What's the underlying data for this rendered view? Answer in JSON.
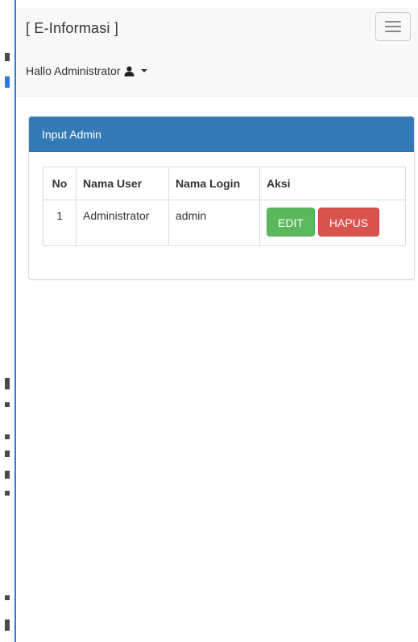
{
  "navbar": {
    "brand": "[ E-Informasi ]",
    "user_label": "Hallo Administrator",
    "user_icon": "user-icon",
    "toggle_icon": "hamburger-icon"
  },
  "panel": {
    "title": "Input Admin"
  },
  "table": {
    "headers": [
      "No",
      "Nama User",
      "Nama Login",
      "Aksi"
    ],
    "rows": [
      {
        "no": "1",
        "nama_user": "Administrator",
        "nama_login": "admin",
        "edit_label": "EDIT",
        "hapus_label": "HAPUS"
      }
    ]
  },
  "colors": {
    "panel_heading": "#337ab7",
    "edit_button": "#5cb85c",
    "hapus_button": "#d9534f",
    "navbar_bg": "#f8f8f8"
  }
}
